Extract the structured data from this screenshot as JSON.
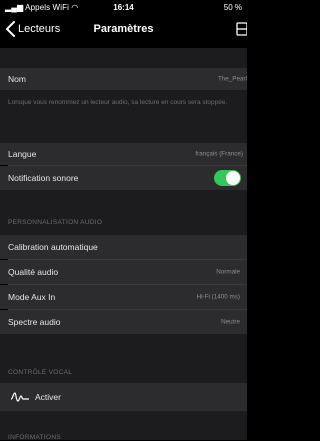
{
  "status_bar": {
    "carrier": "Appels WiFi",
    "time": "16:14",
    "battery": "50 %"
  },
  "nav": {
    "back_label": "Lecteurs",
    "title": "Paramètres"
  },
  "name_row": {
    "label": "Nom",
    "value": "The_Pearl"
  },
  "rename_note": "Lorsque vous renommez un lecteur audio, sa lecture en cours sera stoppée.",
  "language_row": {
    "label": "Langue",
    "value": "français (France)"
  },
  "notification_row": {
    "label": "Notification sonore",
    "enabled": true
  },
  "audio_section": {
    "header": "PERSONNALISATION AUDIO",
    "rows": [
      {
        "label": "Calibration automatique",
        "value": ""
      },
      {
        "label": "Qualité audio",
        "value": "Normale"
      },
      {
        "label": "Mode Aux In",
        "value": "Hi-Fi (1400 ms)"
      },
      {
        "label": "Spectre audio",
        "value": "Neutre"
      }
    ]
  },
  "voice_section": {
    "header": "CONTRÔLE VOCAL",
    "activate_label": "Activer"
  },
  "info_section": {
    "header": "INFORMATIONS"
  },
  "colors": {
    "toggle_on": "#34c759",
    "cell_bg": "#2c2c2e",
    "group_bg": "#1c1c1e"
  }
}
